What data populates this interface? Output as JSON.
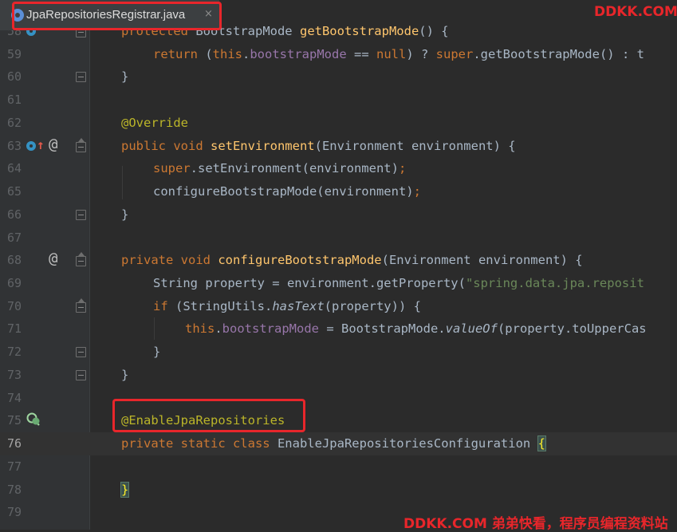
{
  "tab": {
    "title": "JpaRepositoriesRegistrar.java",
    "close": "×"
  },
  "watermark": {
    "top": "DDKK.COM",
    "bottom": "DDKK.COM 弟弟快看，程序员编程资料站"
  },
  "lines": {
    "l58": {
      "num": "58",
      "kw1": "protected ",
      "t1": "BootstrapMode ",
      "fn": "getBootstrapMode",
      "t2": "() {"
    },
    "l59": {
      "num": "59",
      "kw1": "return ",
      "t1": "(",
      "kw2": "this",
      "t2": ".",
      "fld": "bootstrapMode",
      "t3": " == ",
      "kw3": "null",
      "t4": ") ? ",
      "kw4": "super",
      "t5": ".getBootstrapMode() : t"
    },
    "l60": {
      "num": "60",
      "t1": "}"
    },
    "l61": {
      "num": "61"
    },
    "l62": {
      "num": "62",
      "ann": "@Override"
    },
    "l63": {
      "num": "63",
      "kw1": "public void ",
      "fn": "setEnvironment",
      "t1": "(Environment environment) {"
    },
    "l64": {
      "num": "64",
      "kw1": "super",
      "t1": ".setEnvironment(environment)",
      "kw2": ";"
    },
    "l65": {
      "num": "65",
      "t1": "configureBootstrapMode(environment)",
      "kw1": ";"
    },
    "l66": {
      "num": "66",
      "t1": "}"
    },
    "l67": {
      "num": "67"
    },
    "l68": {
      "num": "68",
      "kw1": "private void ",
      "fn": "configureBootstrapMode",
      "t1": "(Environment environment) {"
    },
    "l69": {
      "num": "69",
      "t1": "String property = environment.getProperty(",
      "str": "\"spring.data.jpa.reposit"
    },
    "l70": {
      "num": "70",
      "kw1": "if ",
      "t1": "(StringUtils.",
      "it": "hasText",
      "t2": "(property)) {"
    },
    "l71": {
      "num": "71",
      "kw1": "this",
      "t1": ".",
      "fld": "bootstrapMode",
      "t2": " = BootstrapMode.",
      "it": "valueOf",
      "t3": "(property.toUpperCas"
    },
    "l72": {
      "num": "72",
      "t1": "}"
    },
    "l73": {
      "num": "73",
      "t1": "}"
    },
    "l74": {
      "num": "74"
    },
    "l75": {
      "num": "75",
      "ann": "@EnableJpaRepositories"
    },
    "l76": {
      "num": "76",
      "kw1": "private static class ",
      "t1": "EnableJpaRepositoriesConfiguration ",
      "brace": "{"
    },
    "l77": {
      "num": "77"
    },
    "l78": {
      "num": "78",
      "brace": "}"
    },
    "l79": {
      "num": "79"
    }
  },
  "colors": {
    "keyword": "#cc7832",
    "field": "#9876aa",
    "method": "#ffc66d",
    "annotation": "#bbb529",
    "string": "#6a8759",
    "highlight": "#e8262b"
  },
  "icons": {
    "l58": "override-circle-icon",
    "l63": [
      "implements-circle-icon",
      "arrow-up-icon",
      "at-icon"
    ],
    "l68": "at-icon",
    "l75": "spring-bean-icon",
    "tab": "java-class-icon"
  }
}
